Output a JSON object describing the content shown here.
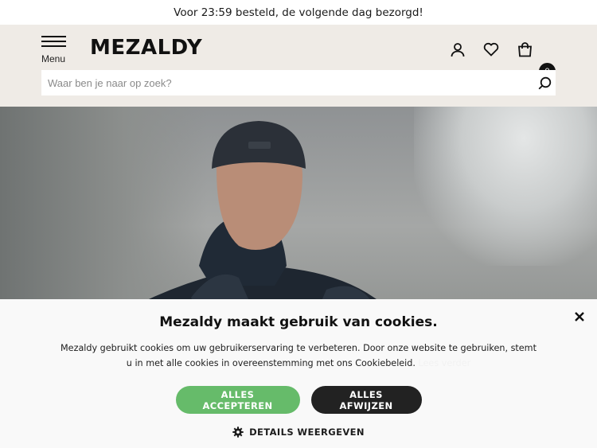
{
  "promo": {
    "text": "Voor 23:59 besteld, de volgende dag bezorgd!"
  },
  "header": {
    "menu_label": "Menu",
    "logo_text": "MEZALDY",
    "cart_count": "0",
    "icons": [
      "user-icon",
      "heart-icon",
      "bag-icon"
    ]
  },
  "search": {
    "placeholder": "Waar ben je naar op zoek?",
    "value": ""
  },
  "cookie": {
    "title": "Mezaldy maakt gebruik van cookies.",
    "text": "Mezaldy gebruikt cookies om uw gebruikerservaring te verbeteren. Door onze website te gebruiken, stemt u in met alle cookies in overeenstemming met ons Cookiebeleid.",
    "read_more": "Lees verder",
    "accept_label": "ALLES ACCEPTEREN",
    "reject_label": "ALLES AFWIJZEN",
    "details_label": "DETAILS WEERGEVEN"
  },
  "colors": {
    "header_bg": "#efebe6",
    "accept": "#66bb6a",
    "reject": "#222222",
    "cookie_bg": "#f9f9f9"
  }
}
